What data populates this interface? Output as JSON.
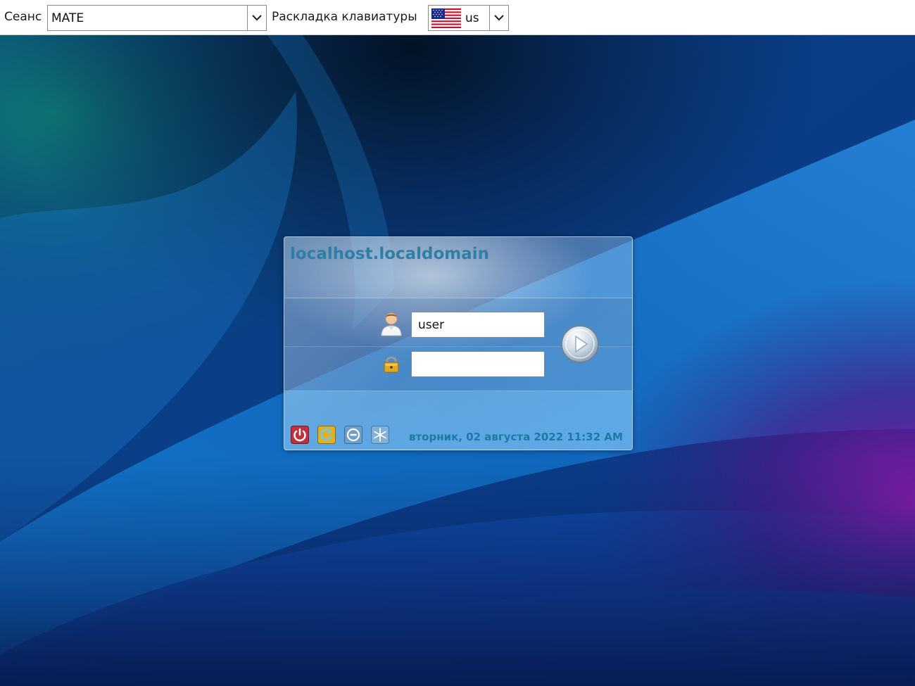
{
  "topbar": {
    "session_label": "Сеанс",
    "session_value": "MATE",
    "layout_label": "Раскладка клавиатуры",
    "layout_value": "us",
    "layout_flag_icon": "us-flag-icon"
  },
  "login": {
    "hostname": "localhost.localdomain",
    "username_value": "user",
    "password_value": "",
    "user_icon": "user-icon",
    "lock_icon": "lock-icon",
    "go_icon": "play-icon",
    "datetime": "вторник, 02 августа 2022 11:32 AM",
    "actions": [
      {
        "icon": "power-icon"
      },
      {
        "icon": "restart-icon"
      },
      {
        "icon": "suspend-icon"
      },
      {
        "icon": "hibernate-icon"
      }
    ]
  },
  "colors": {
    "hostname": "#2e7ea6",
    "datetime": "#1c7aa8",
    "power": "#c0303a",
    "restart": "#e0b020"
  }
}
